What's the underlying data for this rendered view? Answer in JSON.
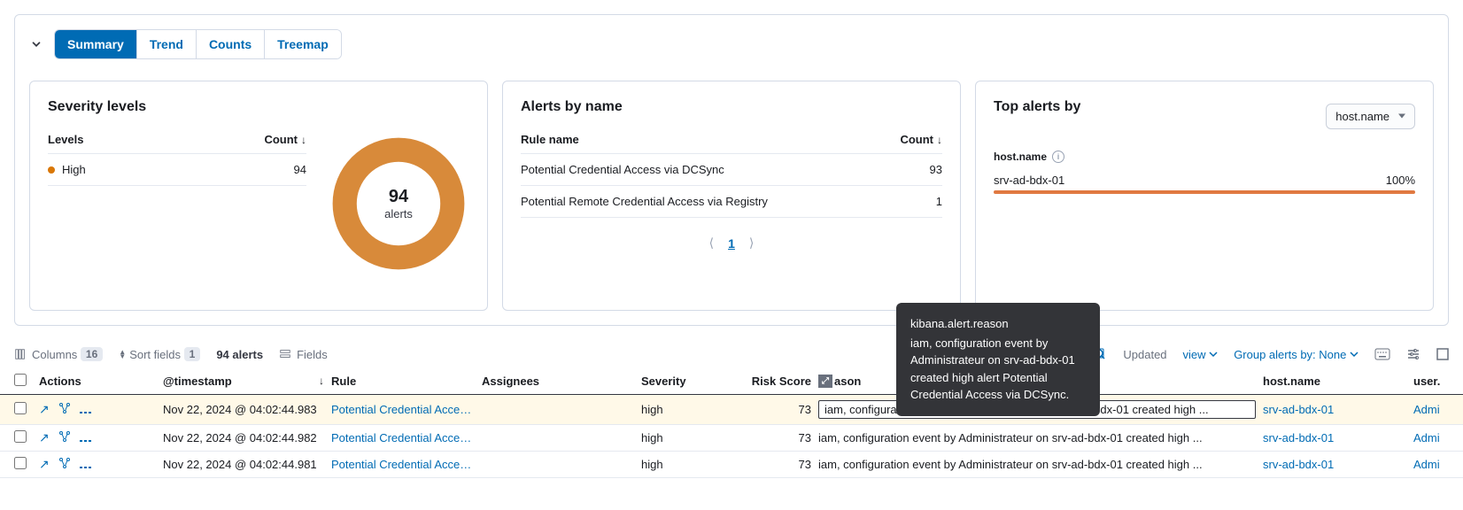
{
  "tabs": {
    "summary": "Summary",
    "trend": "Trend",
    "counts": "Counts",
    "treemap": "Treemap"
  },
  "severity": {
    "title": "Severity levels",
    "levels_header": "Levels",
    "count_header": "Count",
    "rows": [
      {
        "label": "High",
        "count": "94"
      }
    ],
    "donut_value": "94",
    "donut_label": "alerts"
  },
  "by_name": {
    "title": "Alerts by name",
    "rule_header": "Rule name",
    "count_header": "Count",
    "rows": [
      {
        "name": "Potential Credential Access via DCSync",
        "count": "93"
      },
      {
        "name": "Potential Remote Credential Access via Registry",
        "count": "1"
      }
    ],
    "page": "1"
  },
  "top_alerts": {
    "title": "Top alerts by",
    "select_value": "host.name",
    "field_label": "host.name",
    "rows": [
      {
        "name": "srv-ad-bdx-01",
        "pct": "100%"
      }
    ]
  },
  "toolbar": {
    "columns_label": "Columns",
    "columns_count": "16",
    "sort_label": "Sort fields",
    "sort_count": "1",
    "alerts_label": "94 alerts",
    "fields_label": "Fields",
    "updated_label": "Updated",
    "view_suffix": "view",
    "group_label": "Group alerts by: None"
  },
  "table": {
    "headers": {
      "actions": "Actions",
      "timestamp": "@timestamp",
      "rule": "Rule",
      "assignees": "Assignees",
      "severity": "Severity",
      "risk": "Risk Score",
      "reason": "ason",
      "host": "host.name",
      "user": "user."
    },
    "rows": [
      {
        "ts": "Nov 22, 2024 @ 04:02:44.983",
        "rule": "Potential Credential Acces...",
        "severity": "high",
        "risk": "73",
        "reason": "iam, configuration event by Administrateur on srv-ad-bdx-01 created high ...",
        "host": "srv-ad-bdx-01",
        "user": "Admi"
      },
      {
        "ts": "Nov 22, 2024 @ 04:02:44.982",
        "rule": "Potential Credential Acces...",
        "severity": "high",
        "risk": "73",
        "reason": "iam, configuration event by Administrateur on srv-ad-bdx-01 created high ...",
        "host": "srv-ad-bdx-01",
        "user": "Admi"
      },
      {
        "ts": "Nov 22, 2024 @ 04:02:44.981",
        "rule": "Potential Credential Acces...",
        "severity": "high",
        "risk": "73",
        "reason": "iam, configuration event by Administrateur on srv-ad-bdx-01 created high ...",
        "host": "srv-ad-bdx-01",
        "user": "Admi"
      }
    ]
  },
  "tooltip": {
    "field": "kibana.alert.reason",
    "text": "iam, configuration event by Administrateur on srv-ad-bdx-01 created high alert Potential Credential Access via DCSync."
  },
  "chart_data": [
    {
      "type": "pie",
      "title": "Severity levels",
      "categories": [
        "High"
      ],
      "values": [
        94
      ],
      "total": 94
    },
    {
      "type": "bar",
      "title": "Top alerts by host.name",
      "categories": [
        "srv-ad-bdx-01"
      ],
      "values": [
        100
      ],
      "xlabel": "",
      "ylabel": "%",
      "ylim": [
        0,
        100
      ]
    }
  ]
}
